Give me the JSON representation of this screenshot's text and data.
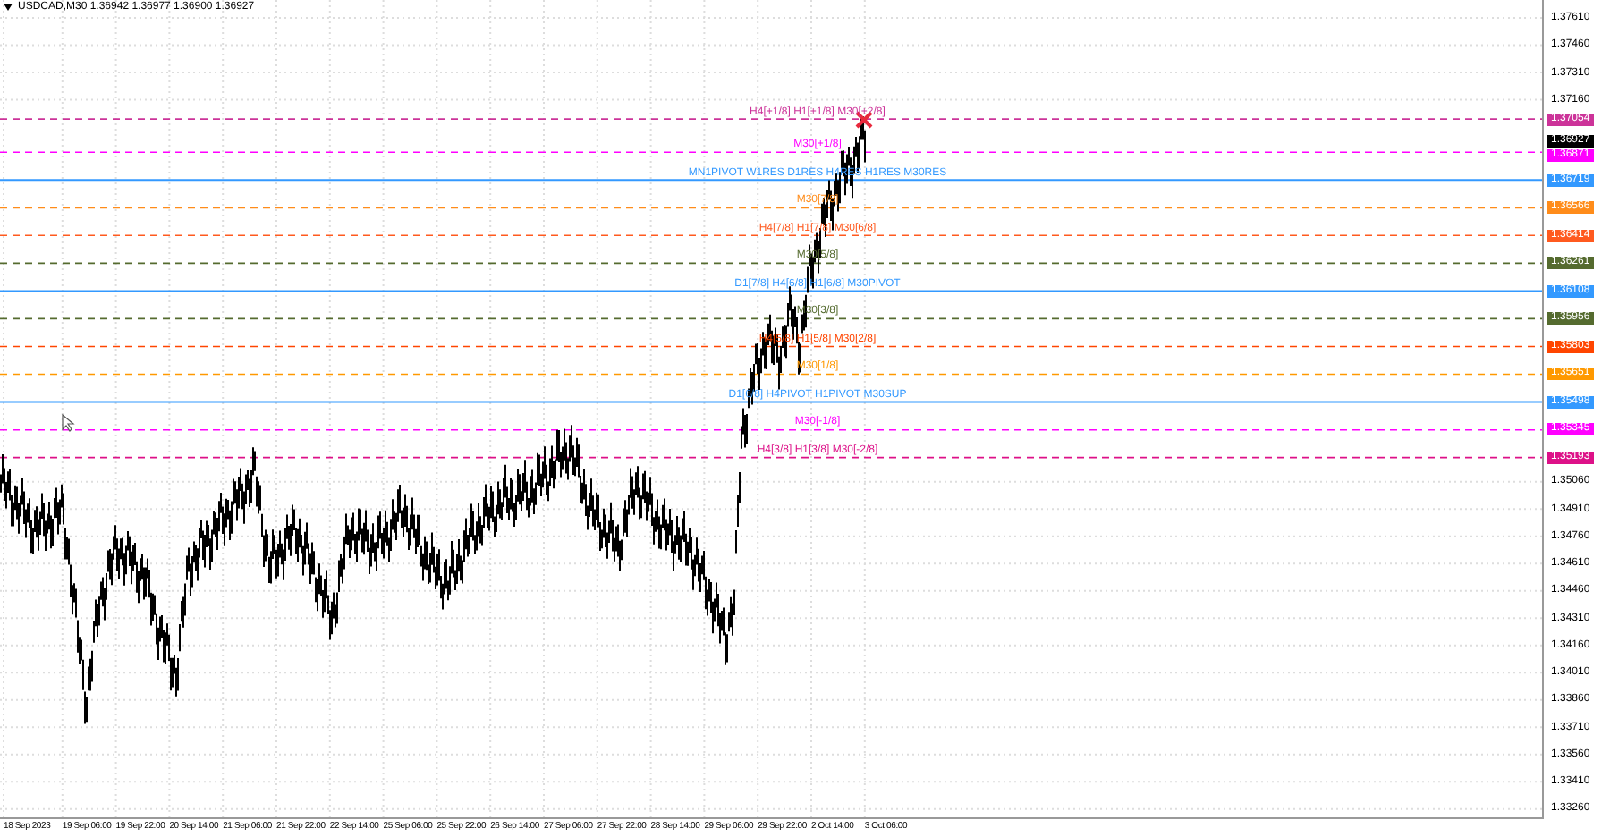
{
  "header": {
    "text": "USDCAD,M30  1.36942 1.36977 1.36900 1.36927"
  },
  "price_axis": [
    "1.37610",
    "1.37460",
    "1.37310",
    "1.37160",
    "1.35060",
    "1.34910",
    "1.34760",
    "1.34610",
    "1.34460",
    "1.34310",
    "1.34160",
    "1.34010",
    "1.33860",
    "1.33710",
    "1.33560",
    "1.33410",
    "1.33260"
  ],
  "levels": [
    {
      "label": "H4[+1/8] H1[+1/8] M30[+2/8]",
      "price": "1.37054",
      "color": "#cc3399",
      "kind": "dashed"
    },
    {
      "label": "M30[+1/8]",
      "price": "1.36871",
      "color": "#ff00ff",
      "kind": "dashed"
    },
    {
      "label": "MN1PIVOT W1RES D1RES H4RES H1RES M30RES",
      "price": "1.36719",
      "color": "#3399ff",
      "kind": "solid"
    },
    {
      "label": "M30[7/8]",
      "price": "1.36566",
      "color": "#ff8c1a",
      "kind": "dashed"
    },
    {
      "label": "H4[7/8] H1[7/8] M30[6/8]",
      "price": "1.36414",
      "color": "#ff5a1f",
      "kind": "dashed"
    },
    {
      "label": "M30[5/8]",
      "price": "1.36261",
      "color": "#556b2f",
      "kind": "dashed"
    },
    {
      "label": "D1[7/8] H4[6/8] H1[6/8] M30PIVOT",
      "price": "1.36108",
      "color": "#3399ff",
      "kind": "solid"
    },
    {
      "label": "M30[3/8]",
      "price": "1.35956",
      "color": "#556b2f",
      "kind": "dashed"
    },
    {
      "label": "H4[5/8] H1[5/8] M30[2/8]",
      "price": "1.35803",
      "color": "#ff4500",
      "kind": "dashed"
    },
    {
      "label": "M30[1/8]",
      "price": "1.35651",
      "color": "#ff9900",
      "kind": "dashed"
    },
    {
      "label": "D1[6/8] H4PIVOT H1PIVOT M30SUP",
      "price": "1.35498",
      "color": "#3399ff",
      "kind": "solid"
    },
    {
      "label": "M30[-1/8]",
      "price": "1.35345",
      "color": "#ff00ff",
      "kind": "dashed"
    },
    {
      "label": "H4[3/8] H1[3/8] M30[-2/8]",
      "price": "1.35193",
      "color": "#dd1188",
      "kind": "dashed"
    }
  ],
  "current_price": "1.36927",
  "time_axis": [
    "18 Sep 2023",
    "19 Sep 06:00",
    "19 Sep 22:00",
    "20 Sep 14:00",
    "21 Sep 06:00",
    "21 Sep 22:00",
    "22 Sep 14:00",
    "25 Sep 06:00",
    "25 Sep 22:00",
    "26 Sep 14:00",
    "27 Sep 06:00",
    "27 Sep 22:00",
    "28 Sep 14:00",
    "29 Sep 06:00",
    "29 Sep 22:00",
    "2 Oct 14:00",
    "3 Oct 06:00"
  ]
}
